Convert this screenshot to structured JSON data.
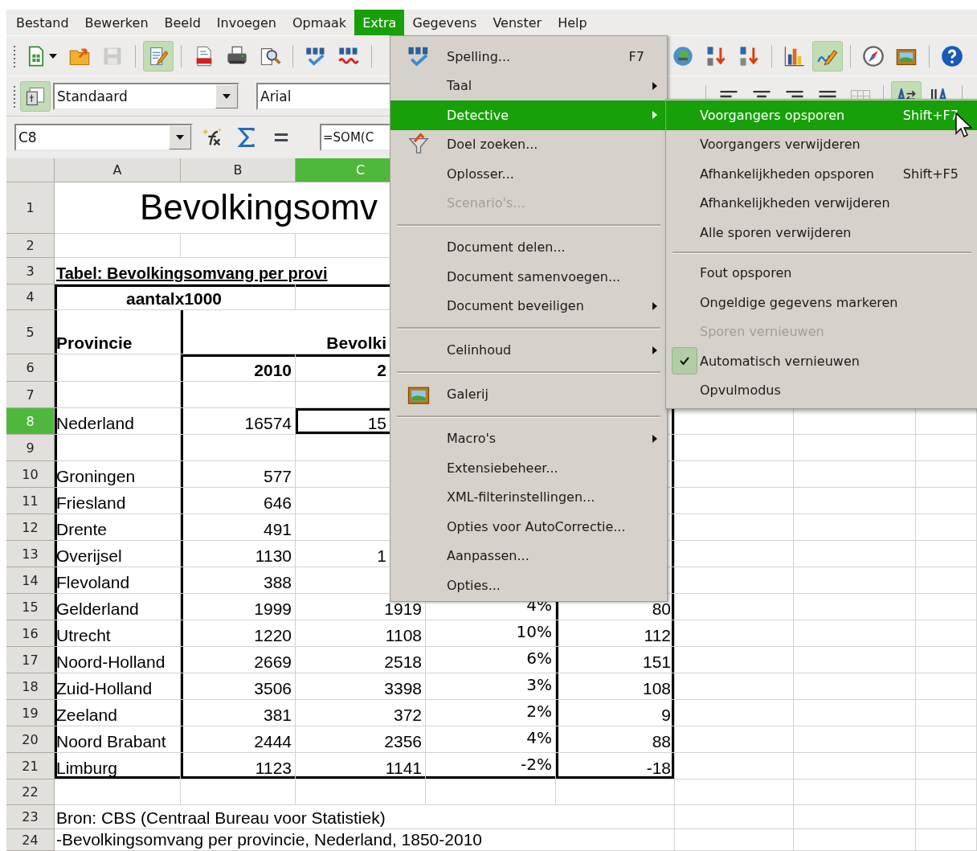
{
  "menubar": [
    {
      "label": "Bestand",
      "selected": false
    },
    {
      "label": "Bewerken",
      "selected": false
    },
    {
      "label": "Beeld",
      "selected": false
    },
    {
      "label": "Invoegen",
      "selected": false
    },
    {
      "label": "Opmaak",
      "selected": false
    },
    {
      "label": "Extra",
      "selected": true
    },
    {
      "label": "Gegevens",
      "selected": false
    },
    {
      "label": "Venster",
      "selected": false
    },
    {
      "label": "Help",
      "selected": false
    }
  ],
  "standard_toolbar": {
    "left": [
      {
        "pressed": false,
        "disabled": false
      },
      {
        "pressed": false,
        "disabled": false
      },
      {
        "pressed": false,
        "disabled": true
      },
      {
        "pressed": true,
        "disabled": false
      },
      {
        "pressed": false,
        "disabled": false
      },
      {
        "pressed": false,
        "disabled": false
      },
      {
        "pressed": false,
        "disabled": false
      },
      {
        "pressed": false,
        "disabled": false
      },
      {
        "pressed": false,
        "disabled": false
      }
    ],
    "right": [
      {
        "pressed": false,
        "disabled": false
      },
      {
        "pressed": false,
        "disabled": false
      },
      {
        "pressed": false,
        "disabled": false
      },
      {
        "pressed": false,
        "disabled": false
      },
      {
        "pressed": true,
        "disabled": false
      },
      {
        "pressed": false,
        "disabled": false
      },
      {
        "pressed": false,
        "disabled": false
      },
      {
        "pressed": false,
        "disabled": false
      }
    ]
  },
  "formatting_toolbar": {
    "styles_button": {
      "pressed": true,
      "disabled": false
    },
    "style": "Standaard",
    "font": "Arial",
    "right": [
      {
        "pressed": false,
        "disabled": false
      },
      {
        "pressed": false,
        "disabled": false
      },
      {
        "pressed": false,
        "disabled": false
      },
      {
        "pressed": false,
        "disabled": false
      },
      {
        "pressed": false,
        "disabled": true
      },
      {
        "pressed": true,
        "disabled": false
      },
      {
        "pressed": false,
        "disabled": false
      }
    ]
  },
  "formula_bar": {
    "cell": "C8",
    "formula": "=SOM(C"
  },
  "sheet": {
    "columns": [
      {
        "label": "A",
        "selected": false
      },
      {
        "label": "B",
        "selected": false
      },
      {
        "label": "C",
        "selected": true
      }
    ],
    "rows": [
      {
        "number": "1",
        "selected": false,
        "kind": "title",
        "text": "Bevolkingsomv"
      },
      {
        "number": "2",
        "selected": false,
        "kind": "blank"
      },
      {
        "number": "3",
        "selected": false,
        "kind": "caption",
        "text": "Tabel: Bevolkingsomvang per provi"
      },
      {
        "number": "4",
        "selected": false,
        "kind": "unit",
        "text": "aantalx1000"
      },
      {
        "number": "5",
        "selected": false,
        "kind": "header",
        "a": "Provincie",
        "c": "Bevolki"
      },
      {
        "number": "6",
        "selected": false,
        "kind": "years",
        "b": "2010",
        "c": "2"
      },
      {
        "number": "7",
        "selected": false,
        "kind": "blank"
      },
      {
        "number": "8",
        "selected": true,
        "kind": "data",
        "a": "Nederland",
        "b": "16574",
        "c": "15"
      },
      {
        "number": "9",
        "selected": false,
        "kind": "blank"
      },
      {
        "number": "10",
        "selected": false,
        "kind": "data",
        "a": "Groningen",
        "b": "577"
      },
      {
        "number": "11",
        "selected": false,
        "kind": "data",
        "a": "Friesland",
        "b": "646"
      },
      {
        "number": "12",
        "selected": false,
        "kind": "data",
        "a": "Drente",
        "b": "491"
      },
      {
        "number": "13",
        "selected": false,
        "kind": "data",
        "a": "Overijsel",
        "b": "1130",
        "c": "1"
      },
      {
        "number": "14",
        "selected": false,
        "kind": "data",
        "a": "Flevoland",
        "b": "388"
      },
      {
        "number": "15",
        "selected": false,
        "kind": "data",
        "a": "Gelderland",
        "b": "1999",
        "c": "1919",
        "d": "4%",
        "e": "80"
      },
      {
        "number": "16",
        "selected": false,
        "kind": "data",
        "a": "Utrecht",
        "b": "1220",
        "c": "1108",
        "d": "10%",
        "e": "112"
      },
      {
        "number": "17",
        "selected": false,
        "kind": "data",
        "a": "Noord-Holland",
        "b": "2669",
        "c": "2518",
        "d": "6%",
        "e": "151"
      },
      {
        "number": "18",
        "selected": false,
        "kind": "data",
        "a": "Zuid-Holland",
        "b": "3506",
        "c": "3398",
        "d": "3%",
        "e": "108"
      },
      {
        "number": "19",
        "selected": false,
        "kind": "data",
        "a": "Zeeland",
        "b": "381",
        "c": "372",
        "d": "2%",
        "e": "9"
      },
      {
        "number": "20",
        "selected": false,
        "kind": "data",
        "a": "Noord Brabant",
        "b": "2444",
        "c": "2356",
        "d": "4%",
        "e": "88"
      },
      {
        "number": "21",
        "selected": false,
        "kind": "data",
        "a": "Limburg",
        "b": "1123",
        "c": "1141",
        "d": "-2%",
        "e": "-18"
      },
      {
        "number": "22",
        "selected": false,
        "kind": "blank"
      },
      {
        "number": "23",
        "selected": false,
        "kind": "note",
        "text": "Bron: CBS (Centraal Bureau voor Statistiek)"
      },
      {
        "number": "24",
        "selected": false,
        "kind": "note",
        "text": "-Bevolkingsomvang per provincie, Nederland, 1850-2010"
      }
    ]
  },
  "extra_menu": {
    "items": [
      {
        "kind": "item",
        "label": "Spelling...",
        "shortcut": "F7",
        "submenu": false,
        "disabled": false,
        "selected": false
      },
      {
        "kind": "item",
        "label": "Taal",
        "submenu": true,
        "disabled": false,
        "selected": false
      },
      {
        "kind": "item",
        "label": "Detective",
        "submenu": true,
        "disabled": false,
        "selected": true
      },
      {
        "kind": "item",
        "label": "Doel zoeken...",
        "submenu": false,
        "disabled": false,
        "selected": false
      },
      {
        "kind": "item",
        "label": "Oplosser...",
        "submenu": false,
        "disabled": false,
        "selected": false
      },
      {
        "kind": "item",
        "label": "Scenario's...",
        "submenu": false,
        "disabled": true,
        "selected": false
      },
      {
        "kind": "separator"
      },
      {
        "kind": "item",
        "label": "Document delen...",
        "submenu": false,
        "disabled": false,
        "selected": false
      },
      {
        "kind": "item",
        "label": "Document samenvoegen...",
        "submenu": false,
        "disabled": false,
        "selected": false
      },
      {
        "kind": "item",
        "label": "Document beveiligen",
        "submenu": true,
        "disabled": false,
        "selected": false
      },
      {
        "kind": "separator"
      },
      {
        "kind": "item",
        "label": "Celinhoud",
        "submenu": true,
        "disabled": false,
        "selected": false
      },
      {
        "kind": "separator"
      },
      {
        "kind": "item",
        "label": "Galerij",
        "submenu": false,
        "disabled": false,
        "selected": false
      },
      {
        "kind": "separator"
      },
      {
        "kind": "item",
        "label": "Macro's",
        "submenu": true,
        "disabled": false,
        "selected": false
      },
      {
        "kind": "item",
        "label": "Extensiebeheer...",
        "submenu": false,
        "disabled": false,
        "selected": false
      },
      {
        "kind": "item",
        "label": "XML-filterinstellingen...",
        "submenu": false,
        "disabled": false,
        "selected": false
      },
      {
        "kind": "item",
        "label": "Opties voor AutoCorrectie...",
        "submenu": false,
        "disabled": false,
        "selected": false
      },
      {
        "kind": "item",
        "label": "Aanpassen...",
        "submenu": false,
        "disabled": false,
        "selected": false
      },
      {
        "kind": "item",
        "label": "Opties...",
        "submenu": false,
        "disabled": false,
        "selected": false
      }
    ]
  },
  "detective_submenu": {
    "items": [
      {
        "kind": "item",
        "label": "Voorgangers opsporen",
        "shortcut": "Shift+F7",
        "disabled": false,
        "checked": false,
        "selected": true
      },
      {
        "kind": "item",
        "label": "Voorgangers verwijderen",
        "disabled": false,
        "checked": false,
        "selected": false
      },
      {
        "kind": "item",
        "label": "Afhankelijkheden opsporen",
        "shortcut": "Shift+F5",
        "disabled": false,
        "checked": false,
        "selected": false
      },
      {
        "kind": "item",
        "label": "Afhankelijkheden verwijderen",
        "disabled": false,
        "checked": false,
        "selected": false
      },
      {
        "kind": "item",
        "label": "Alle sporen verwijderen",
        "disabled": false,
        "checked": false,
        "selected": false
      },
      {
        "kind": "separator"
      },
      {
        "kind": "item",
        "label": "Fout opsporen",
        "disabled": false,
        "checked": false,
        "selected": false
      },
      {
        "kind": "item",
        "label": "Ongeldige gegevens markeren",
        "disabled": false,
        "checked": false,
        "selected": false
      },
      {
        "kind": "item",
        "label": "Sporen vernieuwen",
        "disabled": true,
        "checked": false,
        "selected": false
      },
      {
        "kind": "item",
        "label": "Automatisch vernieuwen",
        "disabled": false,
        "checked": true,
        "selected": false
      },
      {
        "kind": "item",
        "label": "Opvulmodus",
        "disabled": false,
        "checked": false,
        "selected": false
      }
    ]
  }
}
